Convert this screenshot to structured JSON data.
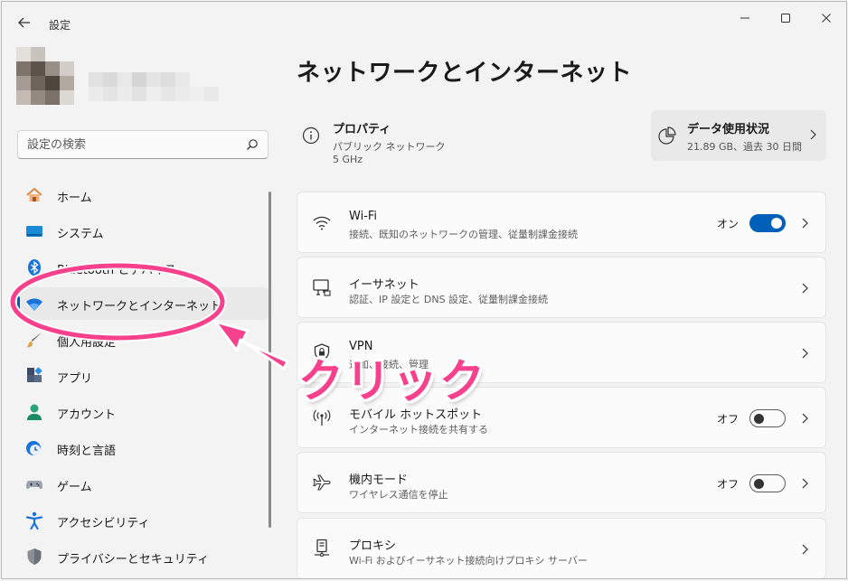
{
  "window": {
    "app_title": "設定",
    "minimize": "—",
    "maximize": "☐",
    "close": "✕"
  },
  "search": {
    "placeholder": "設定の検索"
  },
  "nav": {
    "items": [
      {
        "label": "ホーム",
        "icon": "home-icon"
      },
      {
        "label": "システム",
        "icon": "system-icon"
      },
      {
        "label": "Bluetooth とデバイス",
        "icon": "bluetooth-icon"
      },
      {
        "label": "ネットワークとインターネット",
        "icon": "wifi-icon",
        "selected": true
      },
      {
        "label": "個人用設定",
        "icon": "brush-icon"
      },
      {
        "label": "アプリ",
        "icon": "apps-icon"
      },
      {
        "label": "アカウント",
        "icon": "account-icon"
      },
      {
        "label": "時刻と言語",
        "icon": "clock-globe-icon"
      },
      {
        "label": "ゲーム",
        "icon": "gamepad-icon"
      },
      {
        "label": "アクセシビリティ",
        "icon": "accessibility-icon"
      },
      {
        "label": "プライバシーとセキュリティ",
        "icon": "shield-icon"
      }
    ]
  },
  "main": {
    "title": "ネットワークとインターネット",
    "properties": {
      "title": "プロパティ",
      "network_type": "パブリック ネットワーク",
      "band": "5 GHz"
    },
    "data_usage": {
      "title": "データ使用状況",
      "detail": "21.89 GB、過去 30 日間"
    },
    "cards": [
      {
        "title": "Wi-Fi",
        "desc": "接続、既知のネットワークの管理、従量制課金接続",
        "toggle_label": "オン",
        "toggle_on": true
      },
      {
        "title": "イーサネット",
        "desc": "認証、IP 設定と DNS 設定、従量制課金接続"
      },
      {
        "title": "VPN",
        "desc": "追加、接続、管理"
      },
      {
        "title": "モバイル ホットスポット",
        "desc": "インターネット接続を共有する",
        "toggle_label": "オフ",
        "toggle_on": false
      },
      {
        "title": "機内モード",
        "desc": "ワイヤレス通信を停止",
        "toggle_label": "オフ",
        "toggle_on": false
      },
      {
        "title": "プロキシ",
        "desc": "Wi-Fi およびイーサネット接続向けプロキシ サーバー"
      }
    ]
  },
  "annotation": {
    "text": "クリック",
    "color": "#f7418d"
  },
  "colors": {
    "accent": "#005fb8",
    "background": "#f3f3f3",
    "card": "#fbfbfb"
  }
}
